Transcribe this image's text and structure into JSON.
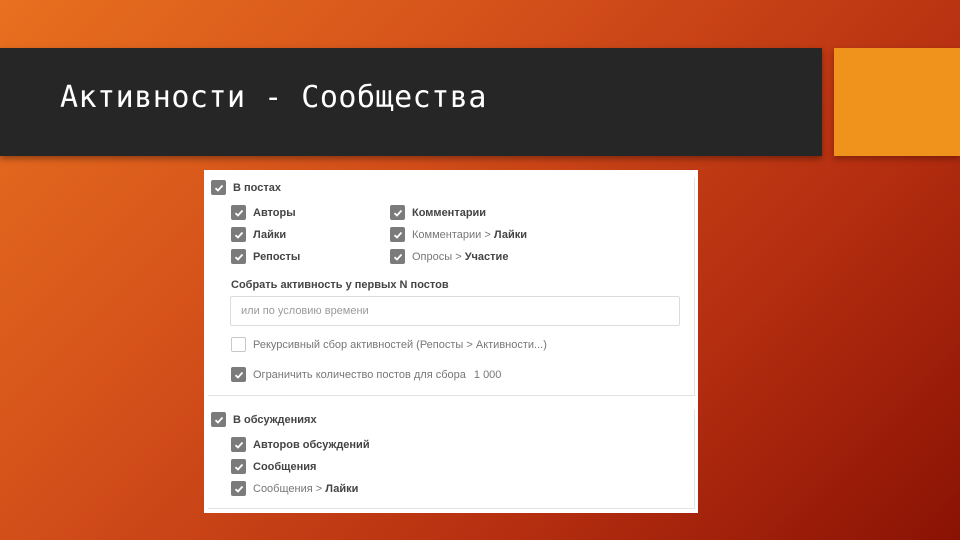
{
  "slide": {
    "title": "Активности - Сообщества"
  },
  "posts": {
    "header": "В постах",
    "left_items": [
      "Авторы",
      "Лайки",
      "Репосты"
    ],
    "right_items": [
      {
        "main": "Комментарии",
        "sub": ""
      },
      {
        "main": "Комментарии > ",
        "sub": "Лайки"
      },
      {
        "main": "Опросы > ",
        "sub": "Участие"
      }
    ],
    "collect_label": "Собрать активность у первых N постов",
    "time_placeholder": "или по условию времени",
    "recursive_label": "Рекурсивный сбор активностей (Репосты > Активности...)",
    "limit_label": "Ограничить количество постов для сбора",
    "limit_value": "1 000"
  },
  "discussions": {
    "header": "В обсуждениях",
    "authors": "Авторов обсуждений",
    "messages": "Сообщения",
    "messages_likes_main": "Сообщения > ",
    "messages_likes_sub": "Лайки"
  },
  "colors": {
    "title_bar": "#262626",
    "accent": "#f0931c",
    "checkbox": "#7b7b7b"
  }
}
